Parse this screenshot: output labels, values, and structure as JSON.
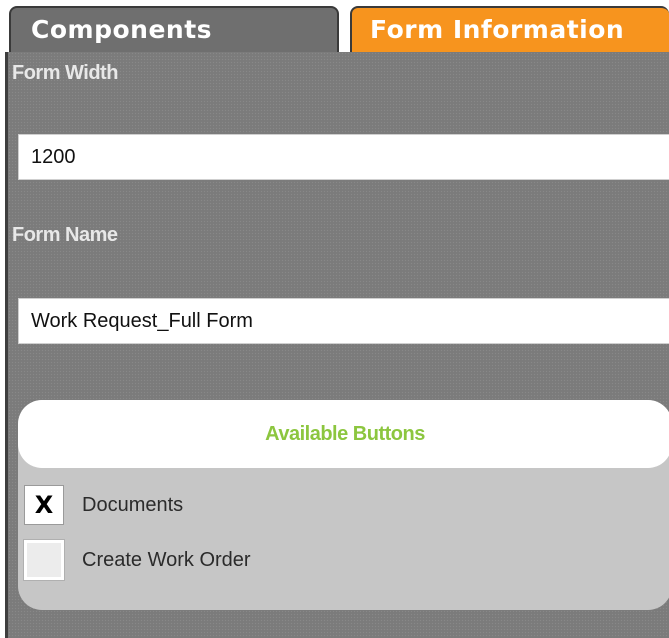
{
  "tabs": {
    "components": "Components",
    "form_information": "Form Information"
  },
  "form": {
    "width_label": "Form Width",
    "width_value": "1200",
    "name_label": "Form Name",
    "name_value": "Work Request_Full Form"
  },
  "available_buttons": {
    "title": "Available Buttons",
    "items": [
      {
        "label": "Documents",
        "checked": true,
        "mark": "X"
      },
      {
        "label": "Create Work Order",
        "checked": false,
        "mark": ""
      }
    ]
  },
  "colors": {
    "active_tab": "#f7941e",
    "inactive_tab": "#6f6f6f",
    "panel_bg": "#7b7b7b",
    "section_title": "#8cc63f"
  }
}
